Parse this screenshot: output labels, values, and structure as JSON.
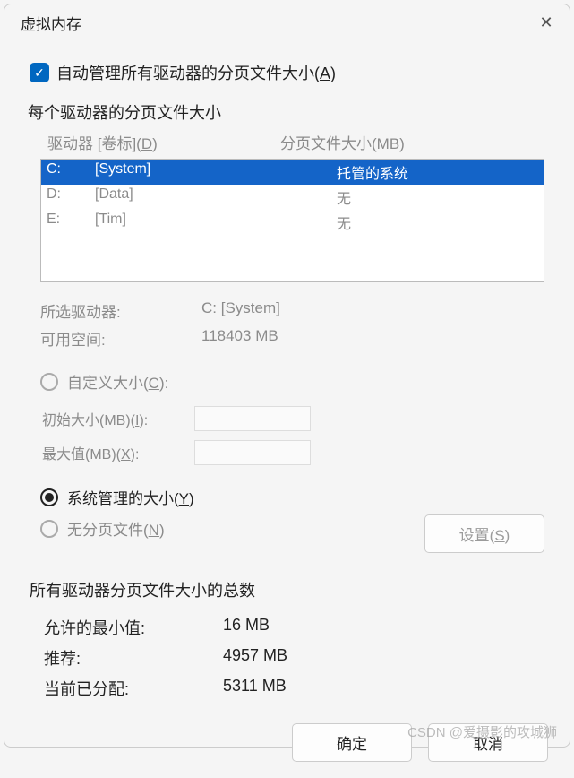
{
  "title": "虚拟内存",
  "auto_manage": {
    "checked": true,
    "label": "自动管理所有驱动器的分页文件大小",
    "accelerator": "A"
  },
  "drives_section": {
    "header": "每个驱动器的分页文件大小",
    "col_drive": "驱动器 [卷标]",
    "col_drive_accel": "D",
    "col_size": "分页文件大小(MB)"
  },
  "drives": [
    {
      "letter": "C:",
      "label": "[System]",
      "size": "托管的系统",
      "selected": true
    },
    {
      "letter": "D:",
      "label": "[Data]",
      "size": "无",
      "selected": false
    },
    {
      "letter": "E:",
      "label": "[Tim]",
      "size": "无",
      "selected": false
    }
  ],
  "selected_info": {
    "drive_label": "所选驱动器:",
    "drive_value": "C:  [System]",
    "space_label": "可用空间:",
    "space_value": "118403 MB"
  },
  "size_options": {
    "custom_label": "自定义大小",
    "custom_accel": "C",
    "initial_label": "初始大小(MB)",
    "initial_accel": "I",
    "max_label": "最大值(MB)",
    "max_accel": "X",
    "system_label": "系统管理的大小",
    "system_accel": "Y",
    "none_label": "无分页文件",
    "none_accel": "N",
    "selected": "system"
  },
  "set_button": {
    "label": "设置",
    "accel": "S"
  },
  "totals": {
    "header": "所有驱动器分页文件大小的总数",
    "rows": [
      {
        "label": "允许的最小值:",
        "value": "16 MB"
      },
      {
        "label": "推荐:",
        "value": "4957 MB"
      },
      {
        "label": "当前已分配:",
        "value": "5311 MB"
      }
    ]
  },
  "buttons": {
    "ok": "确定",
    "cancel": "取消"
  },
  "watermark": "CSDN @爱摄影的攻城狮"
}
